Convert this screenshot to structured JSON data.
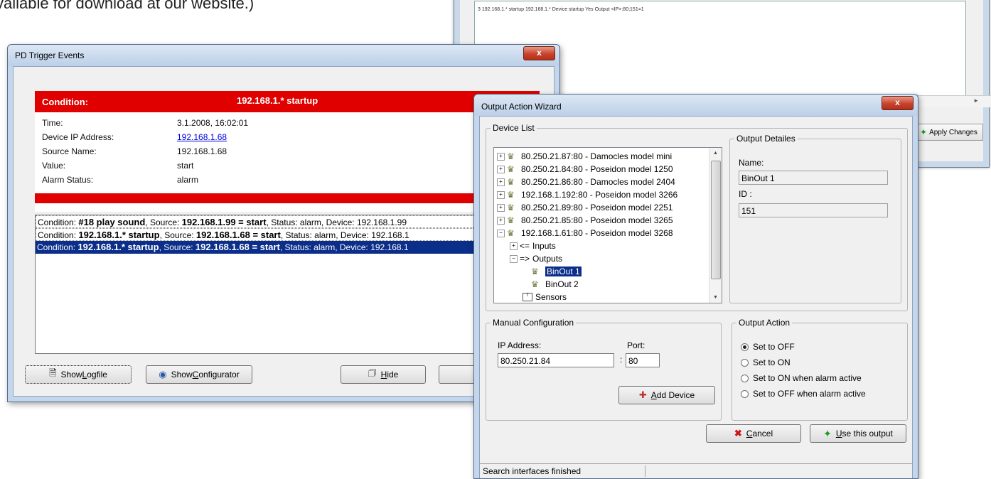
{
  "doc_text": "vailable for download at our website.)",
  "background_window": {
    "row_text": "3    192.168.1.* startup   192.168.1.*          Device startup          Yes     Output              <IP>:80;151=1",
    "apply_label": "Apply Changes"
  },
  "pd_trigger": {
    "title": "PD Trigger Events",
    "close": "x",
    "condition_label": "Condition:",
    "condition_value": "192.168.1.* startup",
    "fields": {
      "time_label": "Time:",
      "time_value": "3.1.2008, 16:02:01",
      "ip_label": "Device IP Address:",
      "ip_value": "192.168.1.68",
      "source_label": "Source Name:",
      "source_value": "192.168.1.68",
      "value_label": "Value:",
      "value_value": "start",
      "alarm_label": "Alarm Status:",
      "alarm_value": "alarm"
    },
    "log": [
      {
        "p1": "Condition: ",
        "b1": "#18 play sound",
        "p2": ", Source: ",
        "b2": "192.168.1.99 = start",
        "p3": ", Status: alarm, Device: 192.168.1.99"
      },
      {
        "p1": "Condition: ",
        "b1": "192.168.1.* startup",
        "p2": ", Source: ",
        "b2": "192.168.1.68 = start",
        "p3": ", Status: alarm, Device: 192.168.1"
      },
      {
        "p1": "Condition: ",
        "b1": "192.168.1.* startup",
        "p2": ", Source: ",
        "b2": "192.168.1.68 = start",
        "p3": ", Status: alarm, Device: 192.168.1"
      }
    ],
    "buttons": {
      "logfile_pre": "Show ",
      "logfile_u": "L",
      "logfile_post": "ogfile",
      "config_pre": "Show ",
      "config_u": "C",
      "config_post": "onfigurator",
      "hide_u": "H",
      "hide_post": "ide"
    }
  },
  "wizard": {
    "title": "Output Action Wizard",
    "close": "x",
    "device_list_legend": "Device List",
    "devices": [
      "80.250.21.87:80 - Damocles model mini",
      "80.250.21.84:80 - Poseidon model 1250",
      "80.250.21.86:80 - Damocles model 2404",
      "192.168.1.192:80 - Poseidon model 3266",
      "80.250.21.89:80 - Poseidon model 2251",
      "80.250.21.85:80 - Poseidon model 3265",
      "192.168.1.61:80 - Poseidon model 3268"
    ],
    "sub_nodes": {
      "inputs": "Inputs",
      "outputs": "Outputs",
      "binout1": "BinOut 1",
      "binout2": "BinOut 2",
      "sensors": "Sensors"
    },
    "output_details_legend": "Output Detailes",
    "name_label": "Name:",
    "name_value": "BinOut 1",
    "id_label": "ID :",
    "id_value": "151",
    "manual_legend": "Manual Configuration",
    "ip_label": "IP Address:",
    "ip_value": "80.250.21.84",
    "port_label": "Port:",
    "port_value": "80",
    "colon": ":",
    "add_device_u": "A",
    "add_device_post": "dd Device",
    "output_action_legend": "Output Action",
    "actions": [
      "Set to OFF",
      "Set to ON",
      "Set to ON when alarm active",
      "Set to OFF when alarm active"
    ],
    "selected_action": 0,
    "cancel_u": "C",
    "cancel_post": "ancel",
    "use_u": "U",
    "use_post": "se this output",
    "status_text": "Search interfaces finished"
  },
  "colors": {
    "alarm_red": "#e00000",
    "selection_blue": "#0a2e8a"
  }
}
